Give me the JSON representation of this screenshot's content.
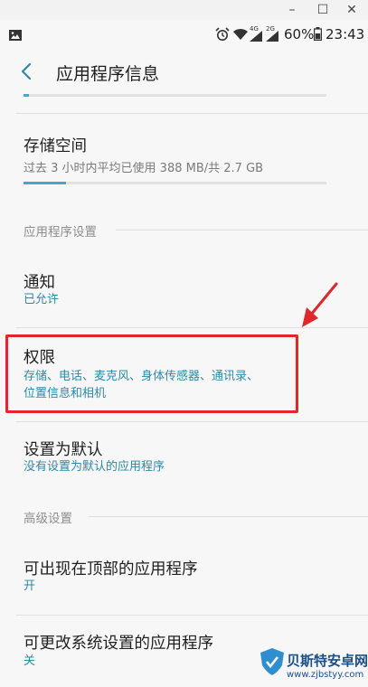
{
  "window": {
    "minimize_glyph": "–",
    "maximize_glyph": "☐",
    "close_glyph": "✕"
  },
  "status_bar": {
    "left_icons": [
      "image-icon"
    ],
    "right_icons": [
      "alarm-icon",
      "wifi-icon",
      "4g-signal-icon",
      "2g-signal-icon",
      "battery-icon"
    ],
    "signal_labels": {
      "first": "4G",
      "second": "2G"
    },
    "battery": "60%",
    "time": "23:43"
  },
  "header": {
    "back_icon": "back-chevron-icon",
    "title": "应用程序信息"
  },
  "storage": {
    "title": "存储空间",
    "subtitle": "过去 3 小时内平均已使用 388 MB/共 2.7 GB",
    "usage_fraction": 0.14
  },
  "top_progress_fraction": 0.02,
  "section_app_settings": "应用程序设置",
  "notifications": {
    "title": "通知",
    "subtitle": "已允许"
  },
  "permissions": {
    "title": "权限",
    "subtitle_line1": "存储、电话、麦克风、身体传感器、通讯录、",
    "subtitle_line2": "位置信息和相机"
  },
  "set_default": {
    "title": "设置为默认",
    "subtitle": "没有设置为默认的应用程序"
  },
  "section_advanced": "高级设置",
  "draw_over": {
    "title": "可出现在顶部的应用程序",
    "subtitle": "开"
  },
  "modify_system": {
    "title": "可更改系统设置的应用程序",
    "subtitle": "关"
  },
  "annotation": {
    "color": "#e0272b"
  },
  "colors": {
    "accent": "#42a7c9",
    "link": "#2b8aa8",
    "highlight_border": "#e0272b"
  },
  "watermark": {
    "name": "贝斯特安卓网",
    "url": "www.zjbstyy.com",
    "logo_icon": "shield-logo-icon"
  }
}
